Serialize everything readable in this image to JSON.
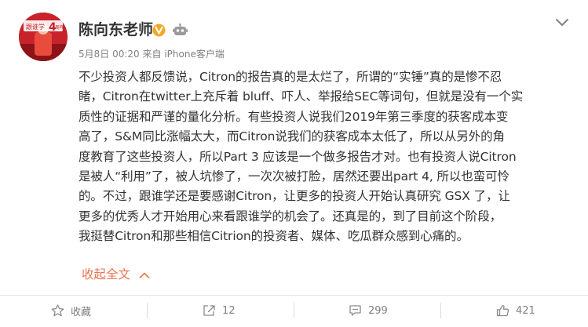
{
  "author": {
    "name": "陈向东老师",
    "avatar_text_small": "跟谁学",
    "avatar_text_big": "4",
    "avatar_text_year": "周年"
  },
  "post": {
    "date": "5月8日 00:20",
    "source": "来自 iPhone客户端",
    "lines": [
      "不少投资人都反馈说，Citron的报告真的是太烂了，所谓的“实锤”真的是惨不忍",
      "睹，Citron在twitter上充斥着 bluff、吓人、举报给SEC等词句，但就是没有一个实",
      "质性的证据和严谨的量化分析。有些投资人说我们2019年第三季度的获客成本变",
      "高了，S&M同比涨幅太大，而Citron说我们的获客成本太低了，所以从另外的角",
      "度教育了这些投资人，所以Part 3 应该是一个做多报告才对。也有投资人说Citron",
      "是被人“利用”了，被人坑惨了，一次次被打脸，居然还要出part 4, 所以也蛮可怜",
      "的。不过，跟谁学还是要感谢Citron，让更多的投资人开始认真研究 GSX 了，让",
      "更多的优秀人才开始用心来看跟谁学的机会了。还真是的，到了目前这个阶段，",
      "我挺替Citron和那些相信Citrion的投资者、媒体、吃瓜群众感到心痛的。"
    ],
    "collapse_label": "收起全文"
  },
  "actions": {
    "favorite": "收藏",
    "repost": "12",
    "comment": "299",
    "like": "421"
  },
  "colors": {
    "accent": "#eb7350",
    "verified": "#f5a623",
    "text": "#333333",
    "meta": "#808080"
  }
}
